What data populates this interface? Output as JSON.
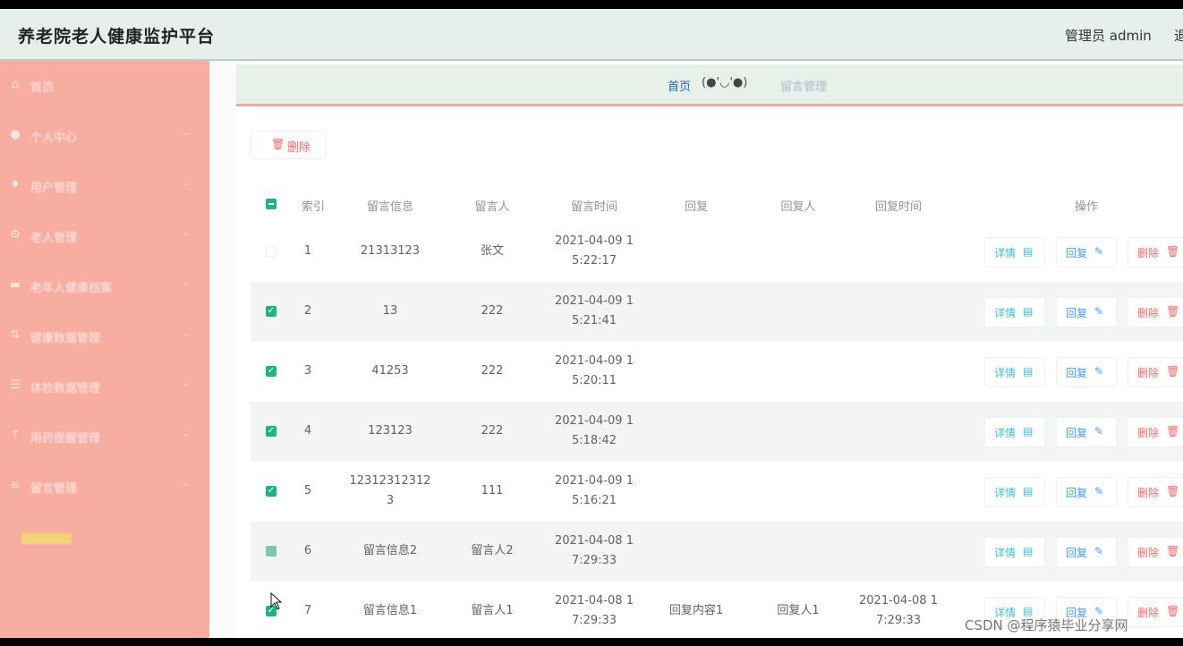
{
  "header": {
    "title": "养老院老人健康监护平台",
    "admin_label": "管理员 admin",
    "logout_label": "退"
  },
  "sidebar": {
    "items": [
      {
        "label": "首页",
        "icon": "home-icon",
        "glyph": "⌂"
      },
      {
        "label": "个人中心",
        "icon": "user-icon",
        "glyph": "●"
      },
      {
        "label": "用户管理",
        "icon": "shield-icon",
        "glyph": "♦"
      },
      {
        "label": "老人管理",
        "icon": "settings-icon",
        "glyph": "⚙"
      },
      {
        "label": "老年人健康档案",
        "icon": "chat-icon",
        "glyph": "▬"
      },
      {
        "label": "健康数据管理",
        "icon": "sort-icon",
        "glyph": "⇅"
      },
      {
        "label": "体检数据管理",
        "icon": "list-icon",
        "glyph": "☰"
      },
      {
        "label": "用药提醒管理",
        "icon": "signal-icon",
        "glyph": "⇡"
      },
      {
        "label": "留言管理",
        "icon": "menu-icon",
        "glyph": "≡"
      }
    ],
    "caret": "⌄"
  },
  "breadcrumb": {
    "home": "首页",
    "face": "(●'◡'●)",
    "current": "留言管理"
  },
  "toolbar": {
    "delete_label": "删除",
    "delete_icon": "🗑"
  },
  "table": {
    "columns": [
      "索引",
      "留言信息",
      "留言人",
      "留言时间",
      "回复",
      "回复人",
      "回复时间",
      "操作"
    ],
    "rows": [
      {
        "index": "1",
        "message": "21313123",
        "author": "张文",
        "time1": "2021-04-09 1",
        "time2": "5:22:17",
        "reply": "",
        "replier": "",
        "rtime1": "",
        "rtime2": "",
        "checked": "off"
      },
      {
        "index": "2",
        "message": "13",
        "author": "222",
        "time1": "2021-04-09 1",
        "time2": "5:21:41",
        "reply": "",
        "replier": "",
        "rtime1": "",
        "rtime2": "",
        "checked": "on"
      },
      {
        "index": "3",
        "message": "41253",
        "author": "222",
        "time1": "2021-04-09 1",
        "time2": "5:20:11",
        "reply": "",
        "replier": "",
        "rtime1": "",
        "rtime2": "",
        "checked": "on"
      },
      {
        "index": "4",
        "message": "123123",
        "author": "222",
        "time1": "2021-04-09 1",
        "time2": "5:18:42",
        "reply": "",
        "replier": "",
        "rtime1": "",
        "rtime2": "",
        "checked": "on"
      },
      {
        "index": "5",
        "message": "12312312312",
        "message2": "3",
        "author": "111",
        "time1": "2021-04-09 1",
        "time2": "5:16:21",
        "reply": "",
        "replier": "",
        "rtime1": "",
        "rtime2": "",
        "checked": "on"
      },
      {
        "index": "6",
        "message": "留言信息2",
        "author": "留言人2",
        "time1": "2021-04-08 1",
        "time2": "7:29:33",
        "reply": "",
        "replier": "",
        "rtime1": "",
        "rtime2": "",
        "checked": "half"
      },
      {
        "index": "7",
        "message": "留言信息1",
        "author": "留言人1",
        "time1": "2021-04-08 1",
        "time2": "7:29:33",
        "reply": "回复内容1",
        "replier": "回复人1",
        "rtime1": "2021-04-08 1",
        "rtime2": "7:29:33",
        "checked": "on"
      }
    ],
    "actions": {
      "detail": "详情",
      "detail_icon": "▤",
      "reply": "回复",
      "reply_icon": "✎",
      "delete": "删除",
      "delete_icon": "🗑"
    },
    "check_glyph": "✓"
  },
  "watermark": "CSDN @程序猿毕业分享网"
}
